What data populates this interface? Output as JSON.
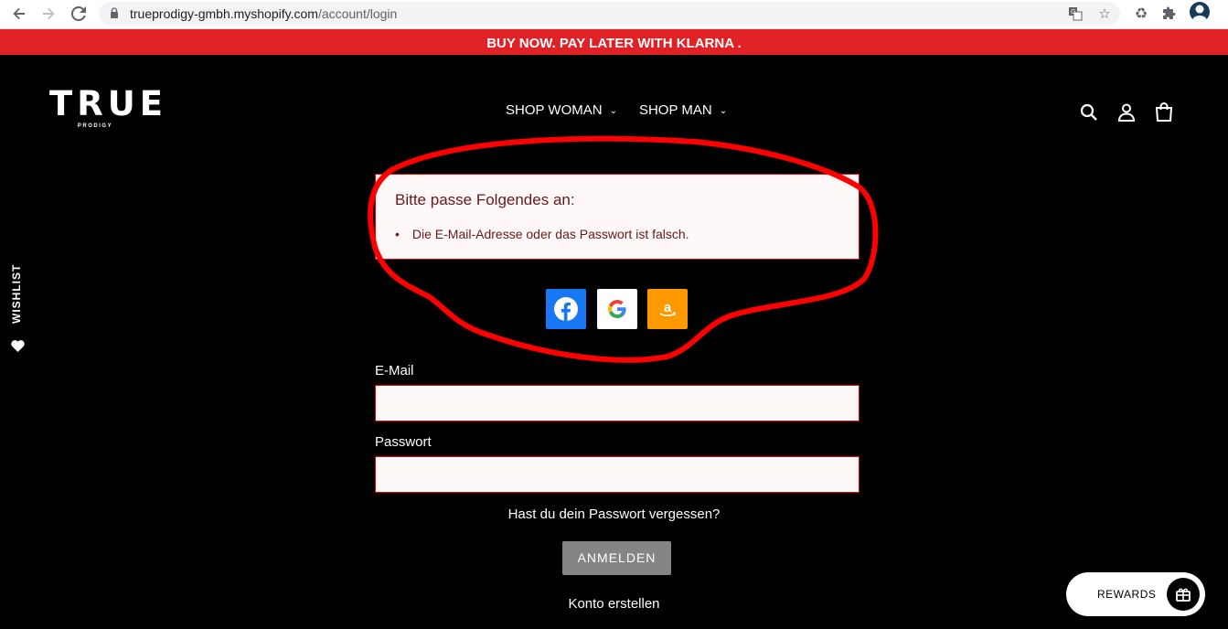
{
  "browser": {
    "url_domain": "trueprodigy-gmbh.myshopify.com",
    "url_path": "/account/login"
  },
  "announcement": "BUY NOW.  PAY LATER WITH KLARNA .",
  "header": {
    "logo_main": "TRUE",
    "logo_sub": "PRODIGY",
    "nav": [
      {
        "label": "SHOP WOMAN"
      },
      {
        "label": "SHOP MAN"
      }
    ]
  },
  "error": {
    "title": "Bitte passe Folgendes an:",
    "items": [
      "Die E-Mail-Adresse oder das Passwort ist falsch."
    ]
  },
  "social_logins": [
    "facebook-icon",
    "google-icon",
    "amazon-icon"
  ],
  "form": {
    "email_label": "E-Mail",
    "password_label": "Passwort",
    "forgot_link": "Hast du dein Passwort vergessen?",
    "submit_label": "ANMELDEN",
    "create_link": "Konto erstellen"
  },
  "wishlist": {
    "label": "WISHLIST"
  },
  "rewards": {
    "label": "REWARDS"
  },
  "colors": {
    "announcement_bg": "#e02126",
    "error_border": "#d9060b",
    "error_text": "#671818",
    "facebook": "#1877f2",
    "amazon": "#ff9900",
    "annotation": "#ff0000"
  }
}
